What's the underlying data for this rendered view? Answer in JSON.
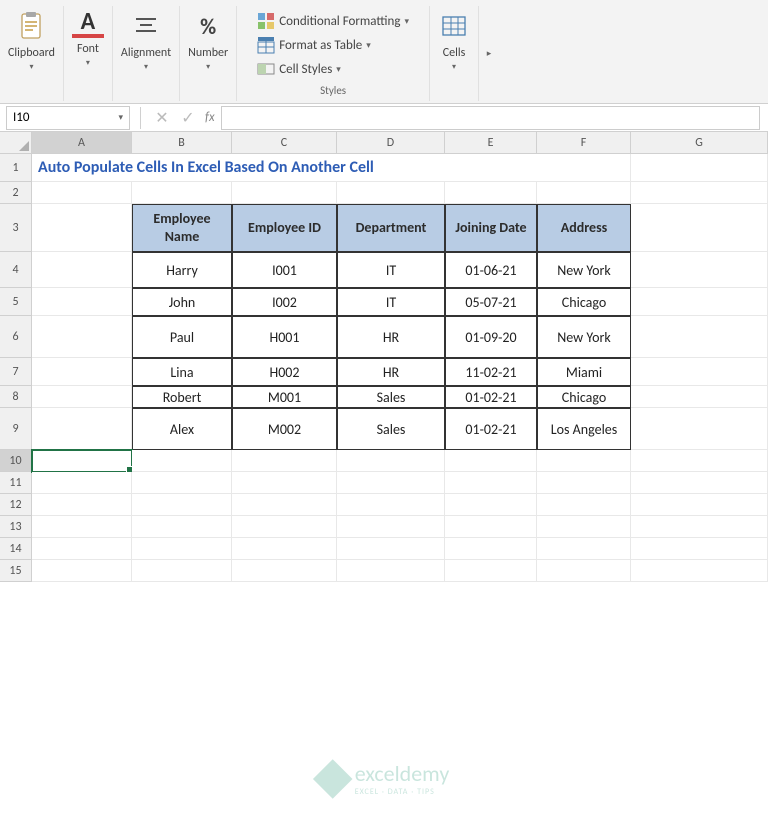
{
  "ribbon": {
    "clipboard": "Clipboard",
    "font": "Font",
    "alignment": "Alignment",
    "number": "Number",
    "cells": "Cells",
    "styles_groupname": "Styles",
    "cond_format": "Conditional Formatting",
    "format_table": "Format as Table",
    "cell_styles": "Cell Styles",
    "number_symbol": "%",
    "font_symbol": "A"
  },
  "namebox": "I10",
  "formula": "",
  "columns": [
    "A",
    "B",
    "C",
    "D",
    "E",
    "F",
    "G"
  ],
  "rows": [
    "1",
    "2",
    "3",
    "4",
    "5",
    "6",
    "7",
    "8",
    "9",
    "10",
    "11",
    "12",
    "13",
    "14",
    "15"
  ],
  "title_text": "Auto Populate Cells In Excel Based On Another Cell",
  "table": {
    "headers": [
      "Employee Name",
      "Employee ID",
      "Department",
      "Joining Date",
      "Address"
    ],
    "rows": [
      [
        "Harry",
        "I001",
        "IT",
        "01-06-21",
        "New York"
      ],
      [
        "John",
        "I002",
        "IT",
        "05-07-21",
        "Chicago"
      ],
      [
        "Paul",
        "H001",
        "HR",
        "01-09-20",
        "New York"
      ],
      [
        "Lina",
        "H002",
        "HR",
        "11-02-21",
        "Miami"
      ],
      [
        "Robert",
        "M001",
        "Sales",
        "01-02-21",
        "Chicago"
      ],
      [
        "Alex",
        "M002",
        "Sales",
        "01-02-21",
        "Los Angeles"
      ]
    ]
  },
  "watermark": {
    "brand": "exceldemy",
    "sub": "EXCEL · DATA · TIPS"
  },
  "selected_cell": "I10",
  "chart_data": null
}
